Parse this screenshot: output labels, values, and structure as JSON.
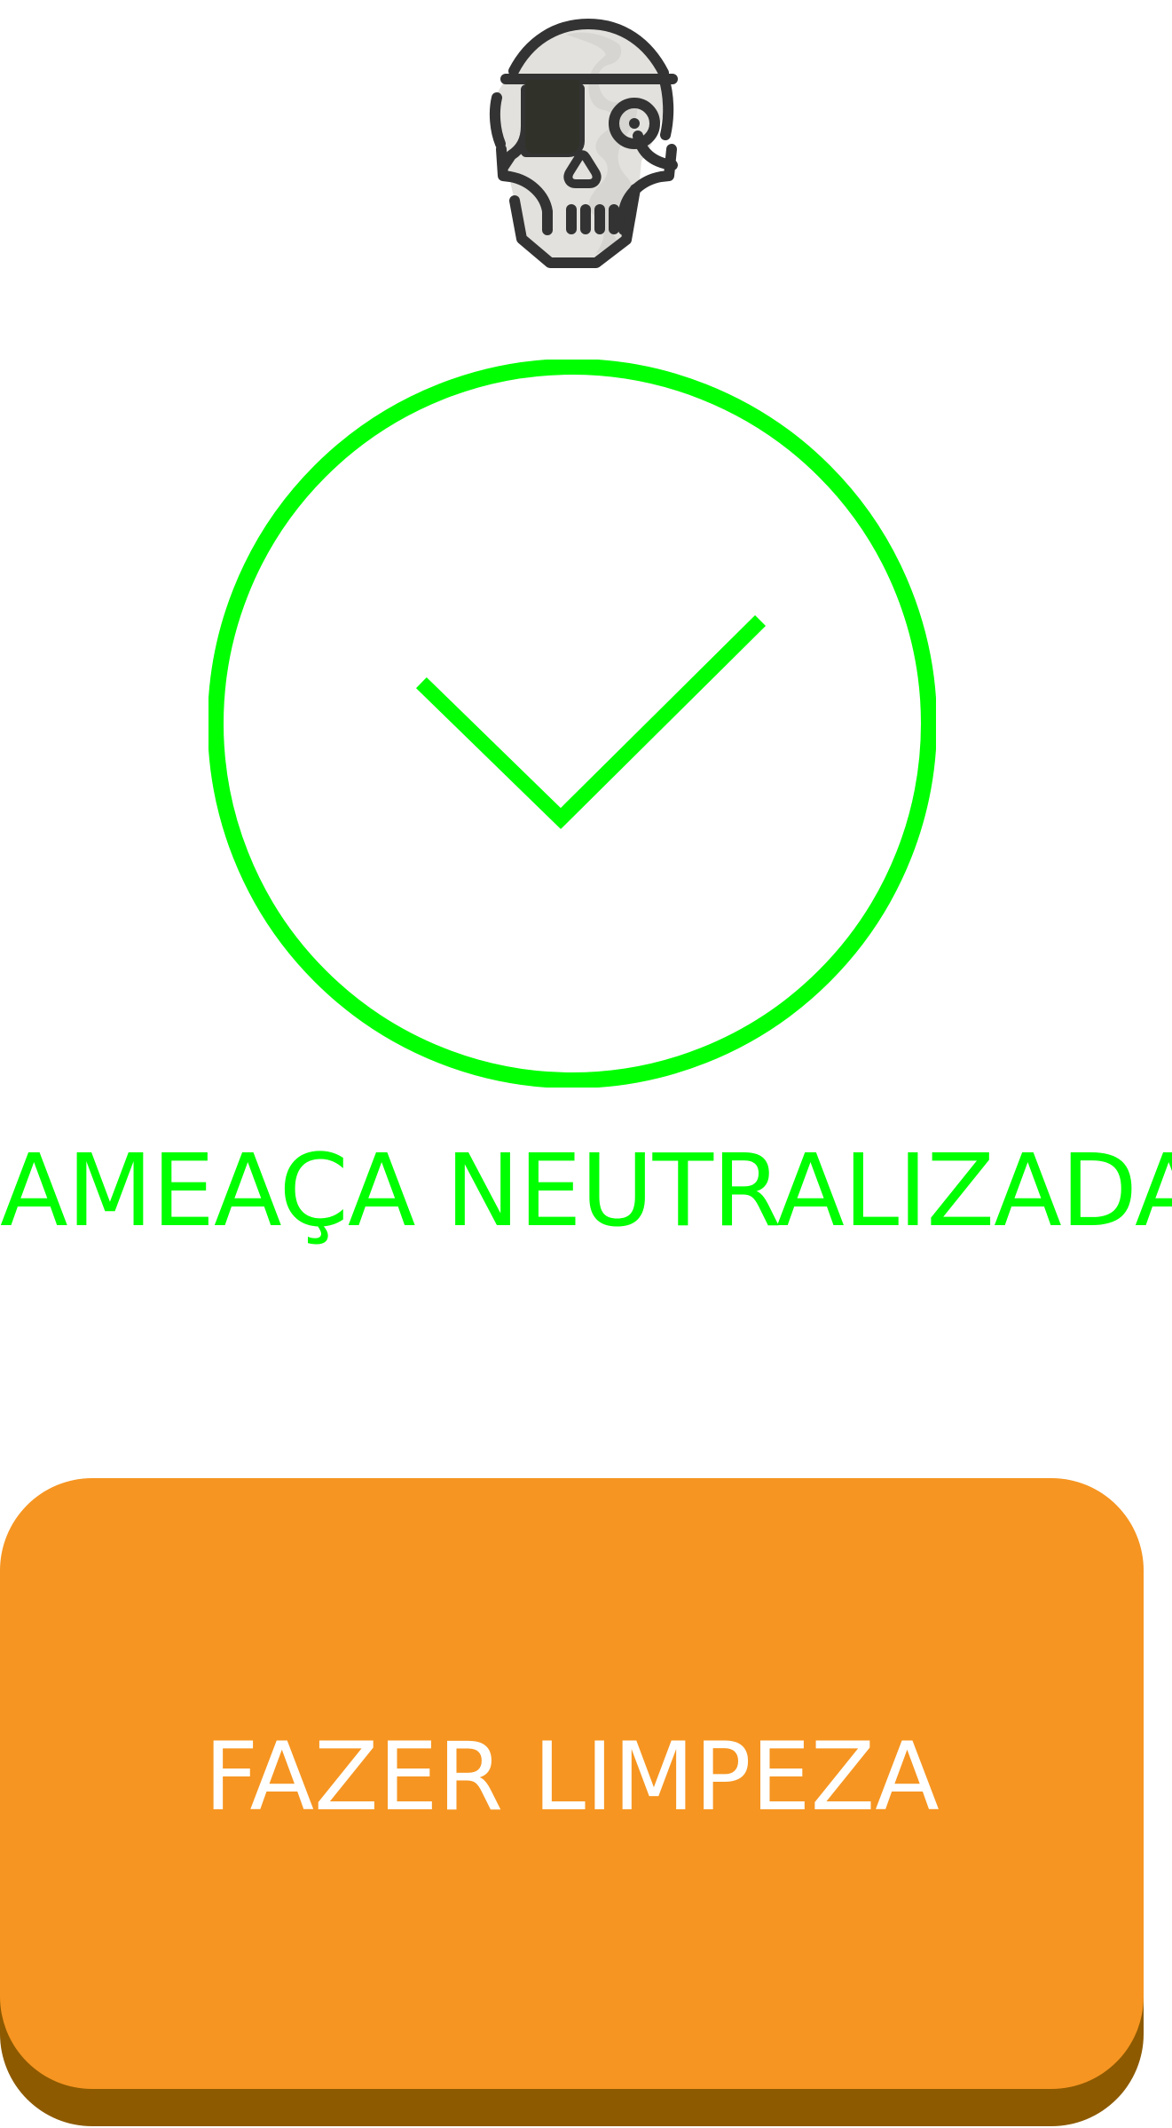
{
  "screen": {
    "status_title": "AMEAÇA NEUTRALIZADA!",
    "success_icon": "checkmark-circle-icon",
    "threat_icon": "pirate-skull-icon"
  },
  "actions": {
    "cleanup_label": "FAZER LIMPEZA"
  },
  "colors": {
    "success": "#00ff00",
    "button_orange": "#f69521",
    "button_shadow": "#8d5a00",
    "skull_outline": "#333333",
    "skull_fill": "#e2e1dd",
    "skull_shadow": "#d6d5d1",
    "skull_dark": "#303229",
    "background": "#ffffff"
  }
}
